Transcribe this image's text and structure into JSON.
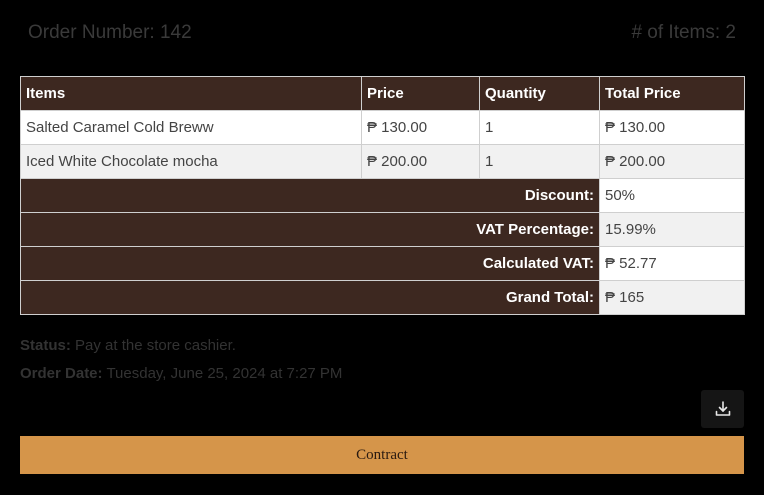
{
  "header": {
    "order_number": "Order Number: 142",
    "item_count": "# of Items: 2"
  },
  "table": {
    "columns": [
      "Items",
      "Price",
      "Quantity",
      "Total Price"
    ],
    "rows": [
      {
        "item": "Salted Caramel Cold Breww",
        "price": "₱ 130.00",
        "quantity": "1",
        "total": "₱ 130.00"
      },
      {
        "item": "Iced White Chocolate mocha",
        "price": "₱ 200.00",
        "quantity": "1",
        "total": "₱ 200.00"
      }
    ],
    "summary": [
      {
        "label": "Discount:",
        "value": "50%"
      },
      {
        "label": "VAT Percentage:",
        "value": "15.99%"
      },
      {
        "label": "Calculated VAT:",
        "value": "₱ 52.77"
      },
      {
        "label": "Grand Total:",
        "value": "₱ 165"
      }
    ]
  },
  "status": {
    "label": "Status:",
    "value": "Pay at the store cashier."
  },
  "order_date": {
    "label": "Order Date:",
    "value": "Tuesday, June 25, 2024 at 7:27 PM"
  },
  "actions": {
    "download_icon": "download-icon",
    "contract_label": "Contract"
  },
  "colors": {
    "page_background": "#000000",
    "header_cell": "#3d2820",
    "accent_button": "#d5954a"
  }
}
